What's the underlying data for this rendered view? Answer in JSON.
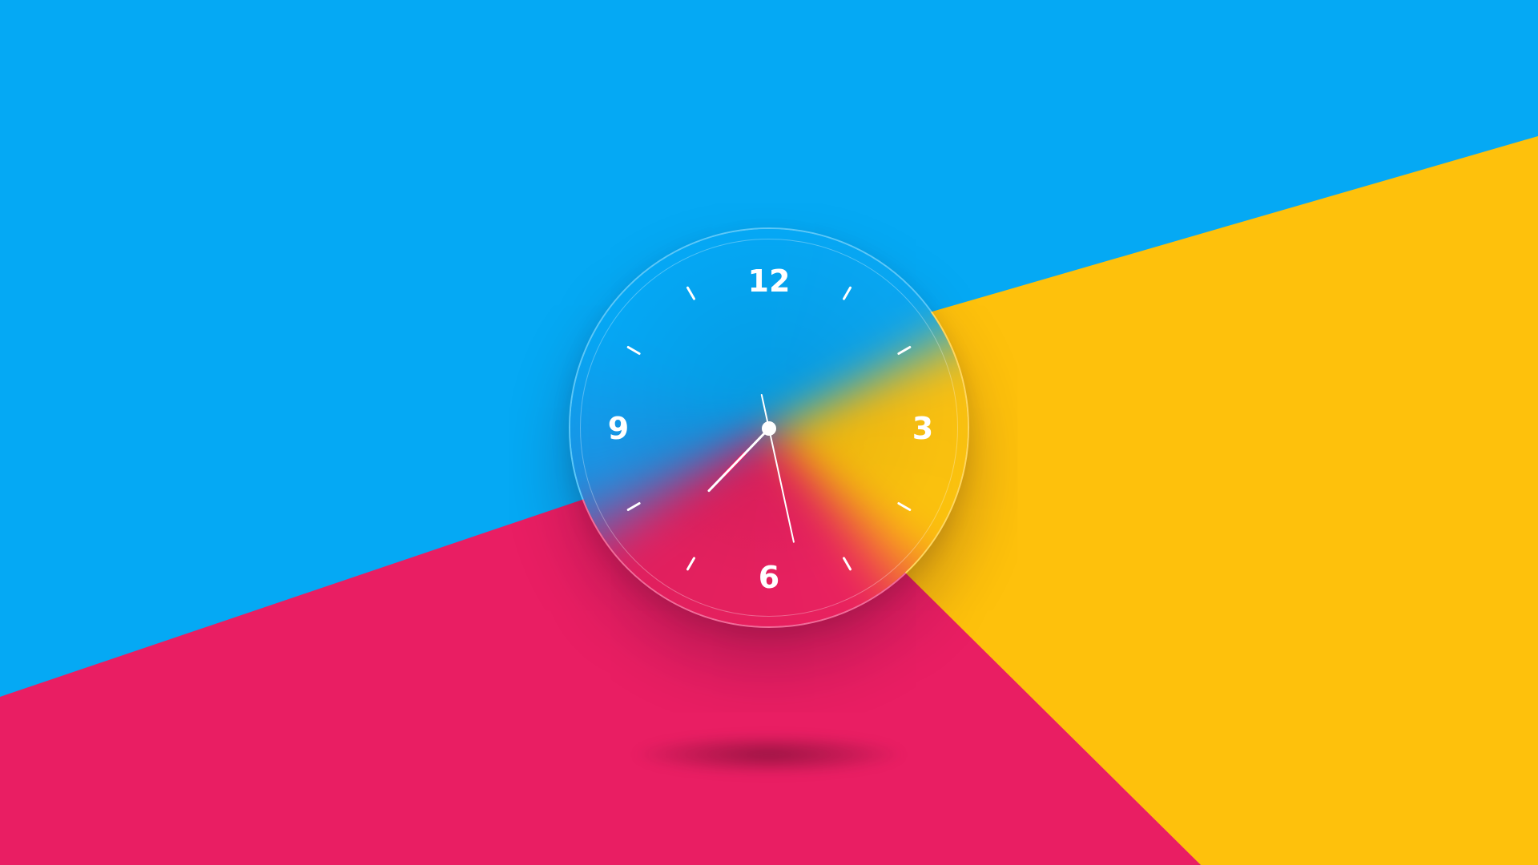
{
  "background": {
    "colors": {
      "blue": "#05a9f4",
      "yellow": "#fec10c",
      "pink": "#e91e63"
    }
  },
  "clock": {
    "numerals": {
      "twelve": "12",
      "three": "3",
      "six": "6",
      "nine": "9"
    },
    "time": {
      "hour": 7,
      "minute": 27,
      "second": 57
    },
    "colors": {
      "hands": "#ffffff",
      "hour_hand_accent": "#e91e63",
      "ticks": "#ffffff"
    }
  }
}
